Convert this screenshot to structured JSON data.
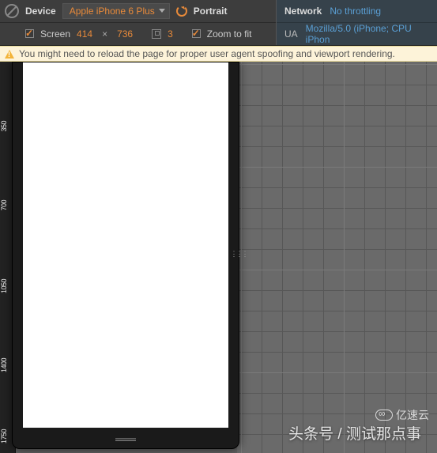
{
  "toolbar": {
    "device_label": "Device",
    "device_value": "Apple iPhone 6 Plus",
    "orientation_label": "Portrait",
    "screen_label": "Screen",
    "screen_width": "414",
    "screen_height": "736",
    "dpr_value": "3",
    "zoom_label": "Zoom to fit",
    "network_label": "Network",
    "network_value": "No throttling",
    "ua_label": "UA",
    "ua_value": "Mozilla/5.0 (iPhone; CPU iPhon"
  },
  "warning": {
    "text": "You might need to reload the page for proper user agent spoofing and viewport rendering."
  },
  "ruler": {
    "t1": "350",
    "t2": "700",
    "t3": "1050",
    "t4": "1400",
    "t5": "1750"
  },
  "watermark": {
    "main": "头条号 / 测试那点事",
    "logo": "亿速云"
  }
}
